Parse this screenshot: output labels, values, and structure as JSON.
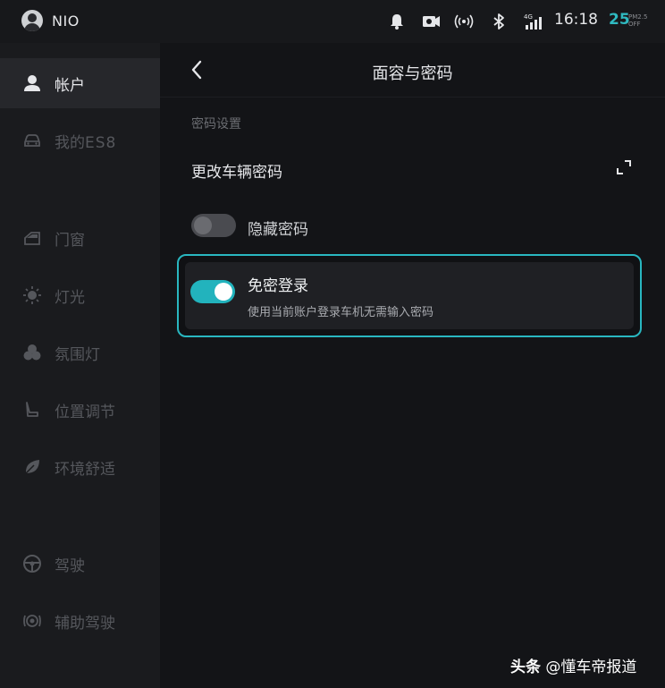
{
  "status_bar": {
    "brand": "NIO",
    "time": "16:18",
    "pm_value": "25",
    "pm_label_top": "PM2.5",
    "pm_label_bottom": "OFF",
    "signal_tag": "4G",
    "icons": [
      "bell-icon",
      "camera-icon",
      "wireless-icon",
      "bluetooth-icon",
      "signal-icon"
    ]
  },
  "sidebar": {
    "items": [
      {
        "label": "帐户",
        "icon": "person-icon",
        "active": true
      },
      {
        "label": "我的",
        "suffix": "ES8",
        "icon": "car-icon",
        "active": false
      },
      {
        "label": "门窗",
        "icon": "door-icon",
        "active": false
      },
      {
        "label": "灯光",
        "icon": "light-icon",
        "active": false
      },
      {
        "label": "氛围灯",
        "icon": "ambient-light-icon",
        "active": false
      },
      {
        "label": "位置调节",
        "icon": "seat-icon",
        "active": false
      },
      {
        "label": "环境舒适",
        "icon": "leaf-icon",
        "active": false
      },
      {
        "label": "驾驶",
        "icon": "steering-wheel-icon",
        "active": false
      },
      {
        "label": "辅助驾驶",
        "icon": "assist-driving-icon",
        "active": false
      }
    ]
  },
  "main": {
    "title": "面容与密码",
    "section_label": "密码设置",
    "change_password": "更改车辆密码",
    "hide_password": {
      "label": "隐藏密码",
      "enabled": false
    },
    "password_free_login": {
      "title": "免密登录",
      "description": "使用当前账户登录车机无需输入密码",
      "enabled": true
    }
  },
  "watermark": {
    "brand": "头条",
    "handle": "@懂车帝报道"
  },
  "colors": {
    "accent": "#22b3bd",
    "background": "#131417",
    "sidebar": "#1a1b1e"
  }
}
